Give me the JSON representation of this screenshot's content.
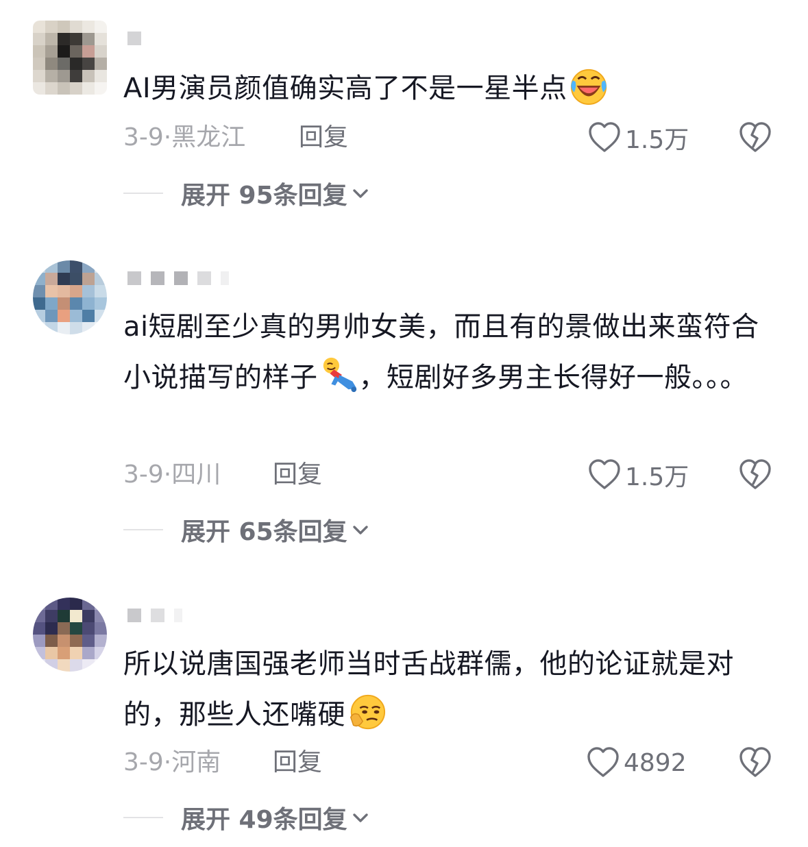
{
  "comments": [
    {
      "text": "AI男演员颜值确实高了不是一星半点",
      "emoji": "laughing-crying-emoji",
      "date": "3-9·",
      "location": "黑龙江",
      "reply_label": "回复",
      "likes": "1.5万",
      "expand_label": "展开 95条回复"
    },
    {
      "text": "ai短剧至少真的男帅女美，而且有的景做出来蛮符合小说描写的样子",
      "emoji": "rolling-on-floor-emoji",
      "text_after": "，短剧好多男主长得好一般。。。",
      "date": "3-9·",
      "location": "四川",
      "reply_label": "回复",
      "likes": "1.5万",
      "expand_label": "展开 65条回复"
    },
    {
      "text": "所以说唐国强老师当时舌战群儒，他的论证就是对的，那些人还嘴硬",
      "emoji": "thinking-smirk-emoji",
      "date": "3-9·",
      "location": "河南",
      "reply_label": "回复",
      "likes": "4892",
      "expand_label": "展开 49条回复"
    }
  ],
  "colors": {
    "text": "#161823",
    "meta": "#a6a7ac",
    "action": "#6e7078",
    "divider": "#e3e3e5"
  }
}
